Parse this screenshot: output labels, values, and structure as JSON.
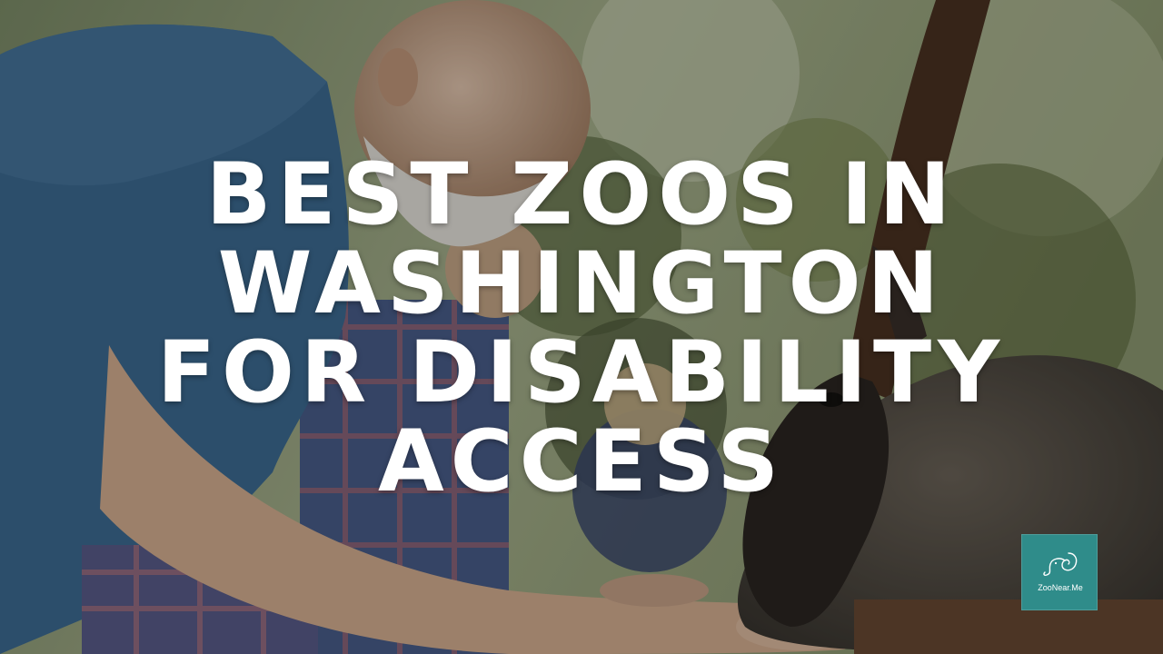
{
  "headline": {
    "line1": "BEST ZOOS IN",
    "line2": "WASHINGTON",
    "line3": "FOR DISABILITY",
    "line4": "ACCESS"
  },
  "logo": {
    "text": "ZooNear.Me",
    "icon": "elephant-icon",
    "bg_color": "#2f8c8a"
  },
  "colors": {
    "headline": "#ffffff",
    "overlay": "#000000"
  }
}
